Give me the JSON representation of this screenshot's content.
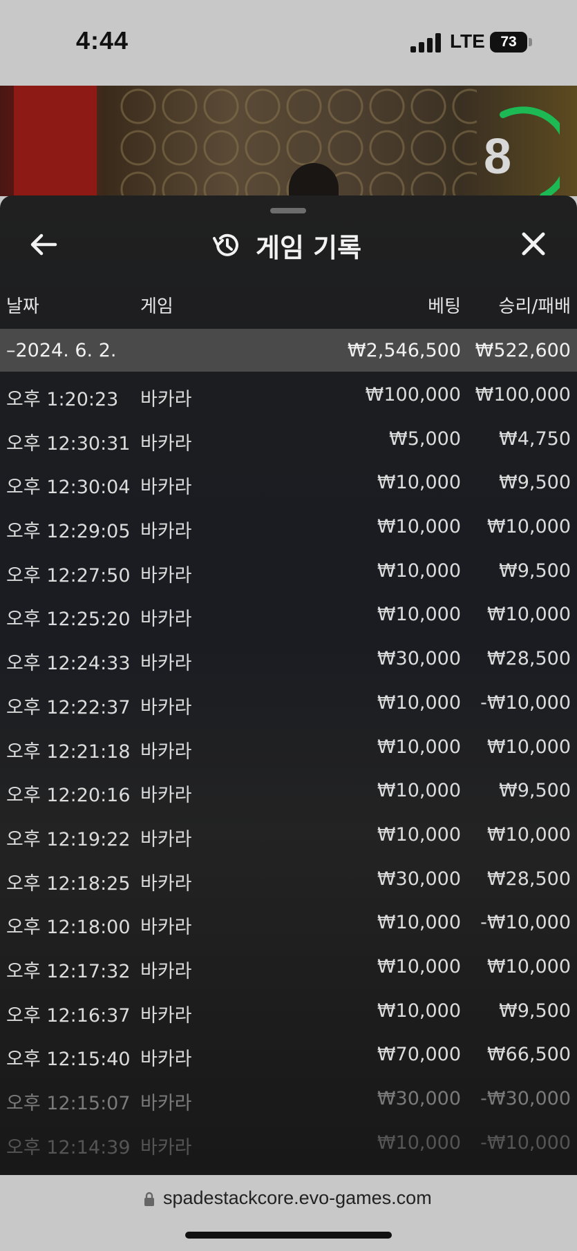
{
  "status": {
    "time": "4:44",
    "network": "LTE",
    "battery": "73"
  },
  "video": {
    "countdown": "8",
    "accent_color": "#1db954"
  },
  "sheet": {
    "title": "게임 기록",
    "icons": {
      "back": "arrow-left-icon",
      "history": "history-icon",
      "close": "close-icon"
    },
    "columns": {
      "date": "날짜",
      "game": "게임",
      "bet": "베팅",
      "result": "승리/패배"
    },
    "summary": {
      "date": "–2024. 6. 2.",
      "bet": "₩2,546,500",
      "result": "₩522,600"
    },
    "rows": [
      {
        "time": "오후 1:20:23",
        "game": "바카라",
        "bet": "₩100,000",
        "result": "₩100,000"
      },
      {
        "time": "오후 12:30:31",
        "game": "바카라",
        "bet": "₩5,000",
        "result": "₩4,750"
      },
      {
        "time": "오후 12:30:04",
        "game": "바카라",
        "bet": "₩10,000",
        "result": "₩9,500"
      },
      {
        "time": "오후 12:29:05",
        "game": "바카라",
        "bet": "₩10,000",
        "result": "₩10,000"
      },
      {
        "time": "오후 12:27:50",
        "game": "바카라",
        "bet": "₩10,000",
        "result": "₩9,500"
      },
      {
        "time": "오후 12:25:20",
        "game": "바카라",
        "bet": "₩10,000",
        "result": "₩10,000"
      },
      {
        "time": "오후 12:24:33",
        "game": "바카라",
        "bet": "₩30,000",
        "result": "₩28,500"
      },
      {
        "time": "오후 12:22:37",
        "game": "바카라",
        "bet": "₩10,000",
        "result": "-₩10,000"
      },
      {
        "time": "오후 12:21:18",
        "game": "바카라",
        "bet": "₩10,000",
        "result": "₩10,000"
      },
      {
        "time": "오후 12:20:16",
        "game": "바카라",
        "bet": "₩10,000",
        "result": "₩9,500"
      },
      {
        "time": "오후 12:19:22",
        "game": "바카라",
        "bet": "₩10,000",
        "result": "₩10,000"
      },
      {
        "time": "오후 12:18:25",
        "game": "바카라",
        "bet": "₩30,000",
        "result": "₩28,500"
      },
      {
        "time": "오후 12:18:00",
        "game": "바카라",
        "bet": "₩10,000",
        "result": "-₩10,000"
      },
      {
        "time": "오후 12:17:32",
        "game": "바카라",
        "bet": "₩10,000",
        "result": "₩10,000"
      },
      {
        "time": "오후 12:16:37",
        "game": "바카라",
        "bet": "₩10,000",
        "result": "₩9,500"
      },
      {
        "time": "오후 12:15:40",
        "game": "바카라",
        "bet": "₩70,000",
        "result": "₩66,500"
      },
      {
        "time": "오후 12:15:07",
        "game": "바카라",
        "bet": "₩30,000",
        "result": "-₩30,000"
      },
      {
        "time": "오후 12:14:39",
        "game": "바카라",
        "bet": "₩10,000",
        "result": "-₩10,000"
      }
    ]
  },
  "browser": {
    "url": "spadestackcore.evo-games.com"
  }
}
